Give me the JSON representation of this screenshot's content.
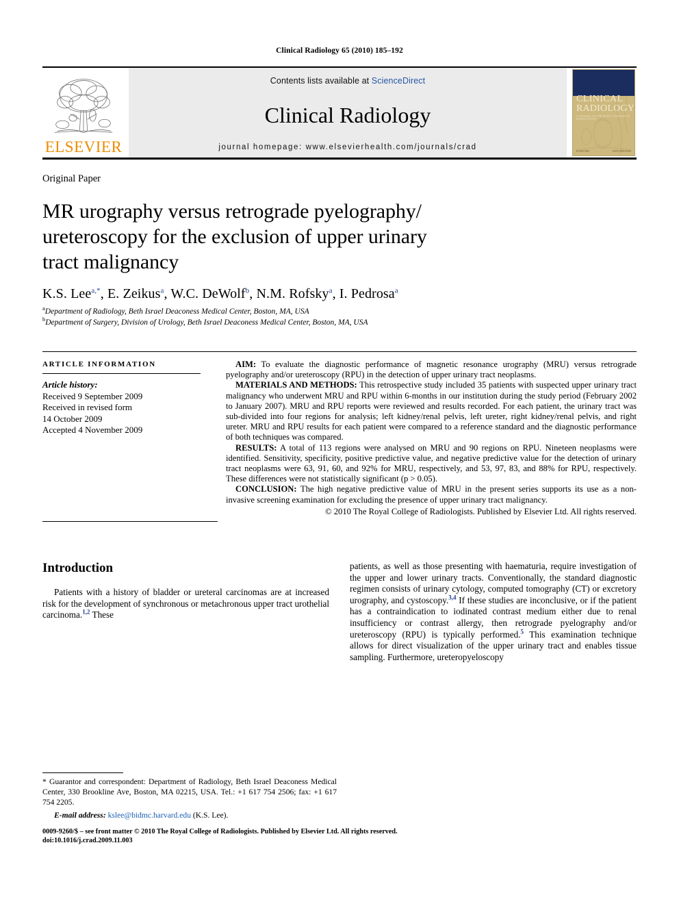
{
  "running_head": "Clinical Radiology 65 (2010) 185–192",
  "masthead": {
    "publisher_name": "ELSEVIER",
    "publisher_logo_icon": "elsevier-tree-icon",
    "contents_prefix": "Contents lists available at ",
    "contents_link": "ScienceDirect",
    "journal_name": "Clinical Radiology",
    "homepage_label": "journal homepage: www.elsevierhealth.com/journals/crad",
    "cover": {
      "title_line1": "CLINICAL",
      "title_line2": "RADIOLOGY",
      "subtitle": "A JOURNAL OF THE ROYAL COLLEGE OF RADIOLOGISTS",
      "footer_left": "ELSEVIER",
      "footer_right": "ISSN 0009-9260",
      "navy_hex": "#1b2c5e",
      "tan_hex": "#cdb87e"
    }
  },
  "article": {
    "type": "Original Paper",
    "title": "MR urography versus retrograde pyelography/ ureteroscopy for the exclusion of upper urinary tract malignancy",
    "authors": [
      {
        "name": "K.S. Lee",
        "marks": "a,*"
      },
      {
        "name": "E. Zeikus",
        "marks": "a"
      },
      {
        "name": "W.C. DeWolf",
        "marks": "b"
      },
      {
        "name": "N.M. Rofsky",
        "marks": "a"
      },
      {
        "name": "I. Pedrosa",
        "marks": "a"
      }
    ],
    "affiliations": [
      {
        "mark": "a",
        "text": "Department of Radiology, Beth Israel Deaconess Medical Center, Boston, MA, USA"
      },
      {
        "mark": "b",
        "text": "Department of Surgery, Division of Urology, Beth Israel Deaconess Medical Center, Boston, MA, USA"
      }
    ]
  },
  "article_info": {
    "heading": "ARTICLE INFORMATION",
    "history_label": "Article history:",
    "history_lines": [
      "Received 9 September 2009",
      "Received in revised form",
      "14 October 2009",
      "Accepted 4 November 2009"
    ]
  },
  "abstract": {
    "aim_label": "AIM:",
    "aim_text": " To evaluate the diagnostic performance of magnetic resonance urography (MRU) versus retrograde pyelography and/or ureteroscopy (RPU) in the detection of upper urinary tract neoplasms.",
    "methods_label": "MATERIALS AND METHODS:",
    "methods_text": " This retrospective study included 35 patients with suspected upper urinary tract malignancy who underwent MRU and RPU within 6-months in our institution during the study period (February 2002 to January 2007). MRU and RPU reports were reviewed and results recorded. For each patient, the urinary tract was sub-divided into four regions for analysis; left kidney/renal pelvis, left ureter, right kidney/renal pelvis, and right ureter. MRU and RPU results for each patient were compared to a reference standard and the diagnostic performance of both techniques was compared.",
    "results_label": "RESULTS:",
    "results_text": " A total of 113 regions were analysed on MRU and 90 regions on RPU. Nineteen neoplasms were identified. Sensitivity, specificity, positive predictive value, and negative predictive value for the detection of urinary tract neoplasms were 63, 91, 60, and 92% for MRU, respectively, and 53, 97, 83, and 88% for RPU, respectively. These differences were not statistically significant (p > 0.05).",
    "conclusion_label": "CONCLUSION:",
    "conclusion_text": " The high negative predictive value of MRU in the present series supports its use as a non-invasive screening examination for excluding the presence of upper urinary tract malignancy.",
    "copyright": "© 2010 The Royal College of Radiologists. Published by Elsevier Ltd. All rights reserved."
  },
  "introduction": {
    "heading": "Introduction",
    "left_text_a": "Patients with a history of bladder or ureteral carcinomas are at increased risk for the development of synchronous or metachronous upper tract urothelial carcinoma.",
    "left_ref_1": "1,2",
    "left_text_b": " These",
    "right_text_a": "patients, as well as those presenting with haematuria, require investigation of the upper and lower urinary tracts. Conventionally, the standard diagnostic regimen consists of urinary cytology, computed tomography (CT) or excretory urography, and cystoscopy.",
    "right_ref_1": "3,4",
    "right_text_b": " If these studies are inconclusive, or if the patient has a contraindication to iodinated contrast medium either due to renal insufficiency or contrast allergy, then retrograde pyelography and/or ureteroscopy (RPU) is typically performed.",
    "right_ref_2": "5",
    "right_text_c": " This examination technique allows for direct visualization of the upper urinary tract and enables tissue sampling. Furthermore, ureteropyeloscopy"
  },
  "footnote": {
    "star_text": "* Guarantor and correspondent: Department of Radiology, Beth Israel Deaconess Medical Center, 330 Brookline Ave, Boston, MA 02215, USA. Tel.: +1 617 754 2506; fax: +1 617 754 2205.",
    "email_label": "E-mail address:",
    "email": "kslee@bidmc.harvard.edu",
    "email_suffix": " (K.S. Lee)."
  },
  "page_footer": {
    "line1": "0009-9260/$ – see front matter © 2010 The Royal College of Radiologists. Published by Elsevier Ltd. All rights reserved.",
    "line2": "doi:10.1016/j.crad.2009.11.003"
  }
}
